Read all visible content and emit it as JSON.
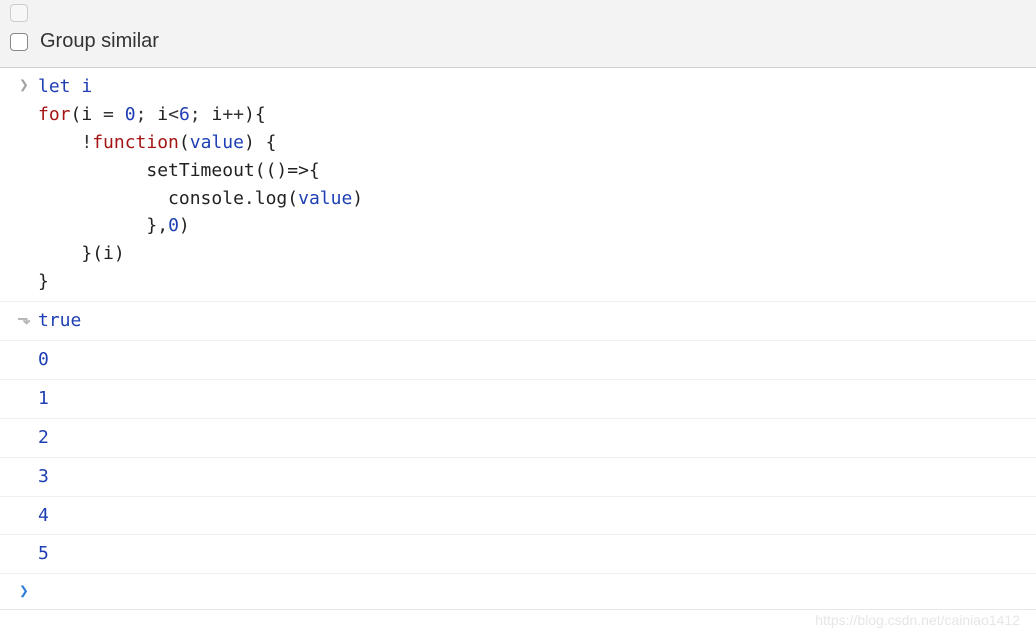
{
  "toolbar": {
    "group_similar_label": "Group similar"
  },
  "code": {
    "tokens": {
      "let": "let",
      "i": "i",
      "for": "for",
      "zero": "0",
      "six": "6",
      "function": "function",
      "value": "value",
      "setTimeout": "setTimeout",
      "console": "console",
      "log": "log",
      "comma_zero": "0"
    }
  },
  "result": {
    "true": "true"
  },
  "outputs": [
    "0",
    "1",
    "2",
    "3",
    "4",
    "5"
  ],
  "watermark": "https://blog.csdn.net/cainiao1412"
}
